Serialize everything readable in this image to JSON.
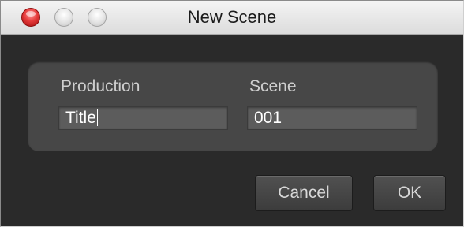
{
  "window": {
    "title": "New Scene"
  },
  "form": {
    "production": {
      "label": "Production",
      "value": "Title"
    },
    "scene": {
      "label": "Scene",
      "value": "001"
    }
  },
  "buttons": {
    "cancel_label": "Cancel",
    "ok_label": "OK"
  },
  "icons": {
    "close": "close-icon",
    "minimize": "minimize-icon",
    "zoom": "zoom-icon"
  },
  "colors": {
    "close_button": "#e63b3b",
    "panel_background": "#2a2a2a",
    "group_background": "#474747",
    "field_background": "#5c5c5c"
  }
}
